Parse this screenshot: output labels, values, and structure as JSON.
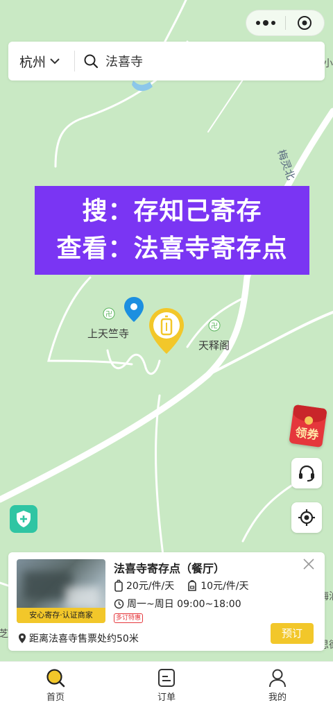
{
  "capsule": {
    "more_icon": "ellipsis-icon",
    "close_icon": "target-ring-icon"
  },
  "search": {
    "city": "杭州",
    "query": "法喜寺"
  },
  "banner": {
    "line1": "搜：存知己寄存",
    "line2": "查看：法喜寺寄存点"
  },
  "map": {
    "places": [
      "上天竺寺",
      "天释阁"
    ],
    "road_label": "梅灵北",
    "edge_labels": [
      "小西",
      "芝龙",
      "梅泊",
      "思德"
    ]
  },
  "floating": {
    "coupon_label": "领券",
    "service_icon": "headset-icon",
    "locate_icon": "locate-icon",
    "shield_icon": "shield-plus-icon"
  },
  "card": {
    "title": "法喜寺寄存点（餐厅）",
    "thumb_tag": "安心寄存·认证商家",
    "price_large": "20元/件/天",
    "price_small": "10元/件/天",
    "hours": "周一~周日 09:00~18:00",
    "promo": "多订特惠",
    "distance": "距离法喜寺售票处约50米",
    "book_label": "预订"
  },
  "tabs": [
    {
      "label": "首页",
      "icon": "search-icon",
      "active": true
    },
    {
      "label": "订单",
      "icon": "order-icon",
      "active": false
    },
    {
      "label": "我的",
      "icon": "user-icon",
      "active": false
    }
  ],
  "colors": {
    "accent": "#f2c72a",
    "banner": "#7a35f3",
    "map": "#c9e9c4",
    "teal": "#2fc5a3",
    "pin_blue": "#1c8fe0"
  }
}
